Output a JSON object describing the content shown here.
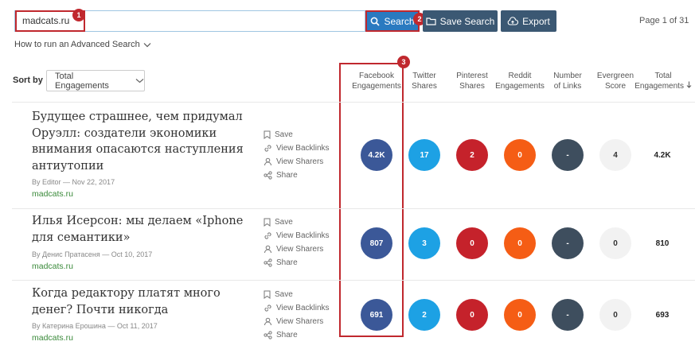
{
  "search": {
    "value": "madcats.ru",
    "button_label": "Search"
  },
  "toolbar": {
    "save_search_label": "Save Search",
    "export_label": "Export"
  },
  "pagination": {
    "label": "Page 1 of 31"
  },
  "advanced_link": "How to run an Advanced Search",
  "sort": {
    "label": "Sort by",
    "selected": "Total Engagements"
  },
  "annotations": [
    "1",
    "2",
    "3"
  ],
  "columns": [
    {
      "line1": "Facebook",
      "line2": "Engagements"
    },
    {
      "line1": "Twitter",
      "line2": "Shares"
    },
    {
      "line1": "Pinterest",
      "line2": "Shares"
    },
    {
      "line1": "Reddit",
      "line2": "Engagements"
    },
    {
      "line1": "Number",
      "line2": "of Links"
    },
    {
      "line1": "Evergreen",
      "line2": "Score"
    },
    {
      "line1": "Total",
      "line2": "Engagements"
    }
  ],
  "actions": {
    "save": "Save",
    "backlinks": "View Backlinks",
    "sharers": "View Sharers",
    "share": "Share"
  },
  "results": [
    {
      "title_lines": [
        "Будущее страшнее, чем придумал",
        "Оруэлл: создатели экономики",
        "внимания опасаются наступления",
        "антиутопии"
      ],
      "by": "By Editor",
      "date": "Nov 22, 2017",
      "domain": "madcats.ru",
      "facebook": "4.2K",
      "twitter": "17",
      "pinterest": "2",
      "reddit": "0",
      "links": "-",
      "evergreen": "4",
      "total": "4.2K"
    },
    {
      "title_lines": [
        "Илья Исерсон: мы делаем «Iphone",
        "для семантики»"
      ],
      "by": "By Денис Пратасеня",
      "date": "Oct 10, 2017",
      "domain": "madcats.ru",
      "facebook": "807",
      "twitter": "3",
      "pinterest": "0",
      "reddit": "0",
      "links": "-",
      "evergreen": "0",
      "total": "810"
    },
    {
      "title_lines": [
        "Когда редактору платят много",
        "денег? Почти никогда"
      ],
      "by": "By Катерина Ерошина",
      "date": "Oct 11, 2017",
      "domain": "madcats.ru",
      "facebook": "691",
      "twitter": "2",
      "pinterest": "0",
      "reddit": "0",
      "links": "-",
      "evergreen": "0",
      "total": "693"
    }
  ],
  "colors": {
    "accent": "#2a7ac0",
    "dark_button": "#3b5873",
    "annotation": "#c0282e",
    "facebook": "#3b5898",
    "twitter": "#1da1e4",
    "pinterest": "#c5222b",
    "reddit": "#f55d15",
    "links": "#3e4e5e",
    "domain_green": "#3a8a3a"
  },
  "icons": {
    "search": "magnifier-icon",
    "save_search": "folder-icon",
    "export": "cloud-upload-icon",
    "save": "bookmark-icon",
    "backlinks": "link-icon",
    "sharers": "user-icon",
    "share": "share-icon",
    "sort_arrow": "arrow-down-icon"
  }
}
